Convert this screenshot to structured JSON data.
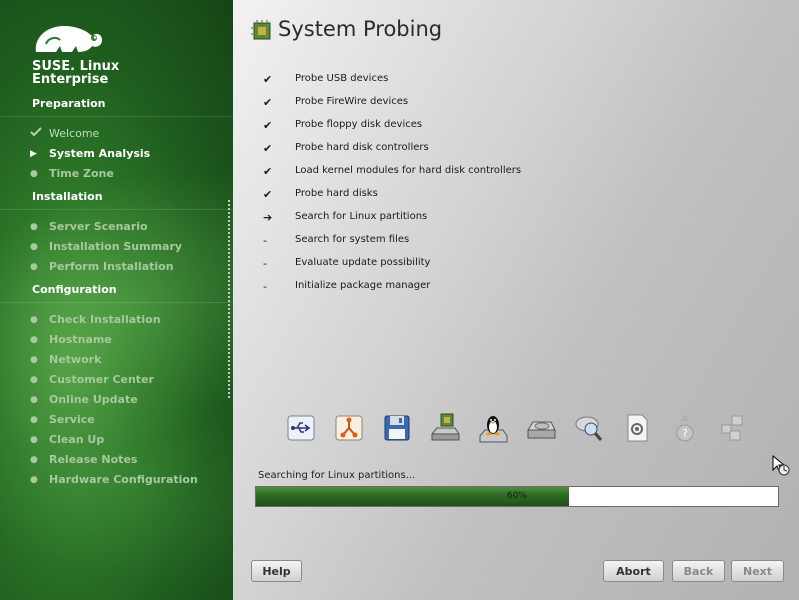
{
  "brand": {
    "line1": "SUSE. Linux",
    "line2": "Enterprise"
  },
  "sidebar": {
    "preparation_title": "Preparation",
    "installation_title": "Installation",
    "configuration_title": "Configuration",
    "preparation": [
      {
        "label": "Welcome",
        "state": "done"
      },
      {
        "label": "System Analysis",
        "state": "active"
      },
      {
        "label": "Time Zone",
        "state": "pending"
      }
    ],
    "installation": [
      {
        "label": "Server Scenario"
      },
      {
        "label": "Installation Summary"
      },
      {
        "label": "Perform Installation"
      }
    ],
    "configuration": [
      {
        "label": "Check Installation"
      },
      {
        "label": "Hostname"
      },
      {
        "label": "Network"
      },
      {
        "label": "Customer Center"
      },
      {
        "label": "Online Update"
      },
      {
        "label": "Service"
      },
      {
        "label": "Clean Up"
      },
      {
        "label": "Release Notes"
      },
      {
        "label": "Hardware Configuration"
      }
    ]
  },
  "main": {
    "title": "System Probing",
    "steps": [
      {
        "mark": "✔",
        "label": "Probe USB devices"
      },
      {
        "mark": "✔",
        "label": "Probe FireWire devices"
      },
      {
        "mark": "✔",
        "label": "Probe floppy disk devices"
      },
      {
        "mark": "✔",
        "label": "Probe hard disk controllers"
      },
      {
        "mark": "✔",
        "label": "Load kernel modules for hard disk controllers"
      },
      {
        "mark": "✔",
        "label": "Probe hard disks"
      },
      {
        "mark": "➔",
        "label": "Search for Linux partitions"
      },
      {
        "mark": "-",
        "label": "Search for system files"
      },
      {
        "mark": "-",
        "label": "Evaluate update possibility"
      },
      {
        "mark": "-",
        "label": "Initialize package manager"
      }
    ],
    "icons": [
      "usb-icon",
      "firewire-icon",
      "floppy-disk-icon",
      "disk-controller-icon",
      "linux-tux-icon",
      "hard-disk-icon",
      "search-partitions-icon",
      "system-files-icon",
      "update-question-icon",
      "package-manager-icon"
    ],
    "status_text": "Searching for Linux partitions...",
    "progress_percent": 60,
    "progress_label": "60%"
  },
  "buttons": {
    "help": "Help",
    "abort": "Abort",
    "back": "Back",
    "next": "Next"
  },
  "colors": {
    "accent_green": "#2d6a24",
    "sidebar_green": "#1f5e1e"
  }
}
